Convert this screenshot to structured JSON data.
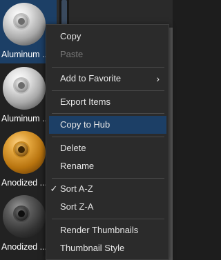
{
  "materials": [
    {
      "name": "Aluminum ...",
      "finish": "silver",
      "selected": true
    },
    {
      "name": "Aluminum ...",
      "finish": "silver",
      "selected": false
    },
    {
      "name": "Anodized ...",
      "finish": "gold",
      "selected": false
    },
    {
      "name": "Anodized ...",
      "finish": "dark",
      "selected": false
    }
  ],
  "menu": {
    "copy": "Copy",
    "paste": "Paste",
    "add_to_favorite": "Add to Favorite",
    "export_items": "Export Items",
    "copy_to_hub": "Copy to Hub",
    "delete": "Delete",
    "rename": "Rename",
    "sort_az": "Sort A-Z",
    "sort_za": "Sort Z-A",
    "render_thumbnails": "Render Thumbnails",
    "thumbnail_style": "Thumbnail Style",
    "check_glyph": "✓",
    "submenu_glyph": "›"
  },
  "colors": {
    "selection": "#1c3f66",
    "menu_background": "#2b2b2b",
    "panel_background": "#222222"
  }
}
